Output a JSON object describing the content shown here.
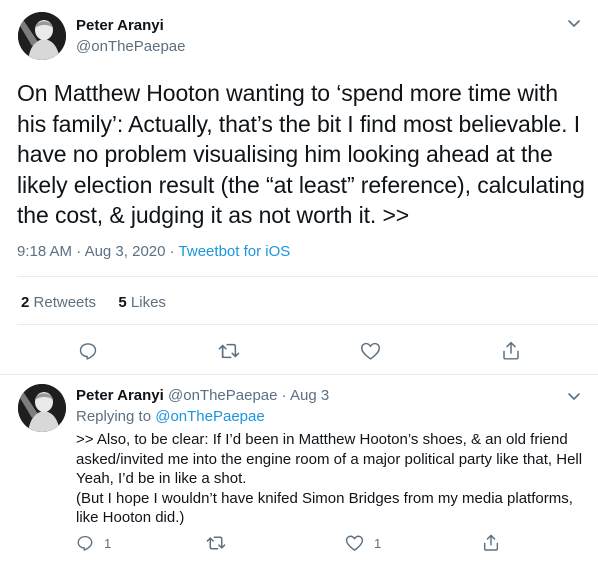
{
  "main_tweet": {
    "author_name": "Peter Aranyi",
    "author_handle": "@onThePaepae",
    "text": "On Matthew Hooton wanting to ‘spend more time with his family’: Actually, that’s the bit I find most believable. I have no problem visualising him looking ahead at the likely election result (the “at least” reference), calculating the cost, & judging it as not worth it. >>",
    "time": "9:18 AM",
    "date": "Aug 3, 2020",
    "separator": "·",
    "source": "Tweetbot for iOS",
    "retweets_count": "2",
    "retweets_label": "Retweets",
    "likes_count": "5",
    "likes_label": "Likes"
  },
  "reply_tweet": {
    "author_name": "Peter Aranyi",
    "author_handle": "@onThePaepae",
    "separator": "·",
    "date": "Aug 3",
    "replying_label": "Replying to",
    "replying_handle": "@onThePaepae",
    "paragraph_1": ">> Also, to be clear: If I’d been in Matthew Hooton’s shoes, & an old friend asked/invited me into the engine room of a major political party like that, Hell Yeah, I’d be in like a shot.",
    "paragraph_2": "(But I hope I wouldn’t have knifed Simon Bridges from my media platforms, like Hooton did.)",
    "reply_count": "1",
    "like_count": "1"
  },
  "icons": {
    "reply": "reply-icon",
    "retweet": "retweet-icon",
    "like": "heart-icon",
    "share": "share-icon",
    "more": "chevron-down-icon"
  },
  "colors": {
    "link": "#1b95e0",
    "muted": "#5b7083",
    "text": "#0f1419",
    "divider": "#e6ecf0"
  }
}
